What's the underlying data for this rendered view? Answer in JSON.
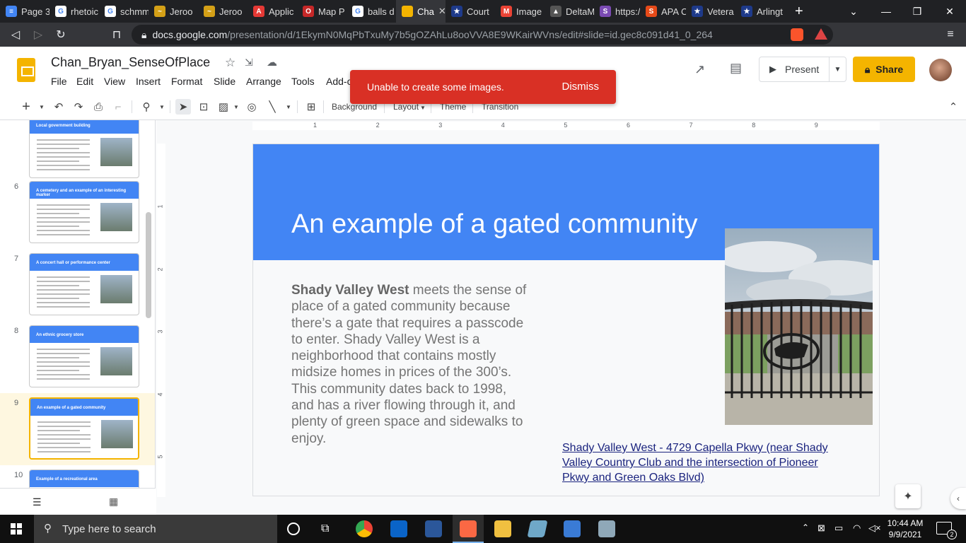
{
  "browser": {
    "tabs": [
      {
        "label": "Page 3",
        "color": "#4285f4",
        "glyph": "≡"
      },
      {
        "label": "rhetoic",
        "color": "#ffffff",
        "glyph": "G"
      },
      {
        "label": "schmm",
        "color": "#ffffff",
        "glyph": "G"
      },
      {
        "label": "Jeroo",
        "color": "#d4a017",
        "glyph": "~"
      },
      {
        "label": "Jeroo",
        "color": "#d4a017",
        "glyph": "~"
      },
      {
        "label": "Applic",
        "color": "#e53935",
        "glyph": "A"
      },
      {
        "label": "Map P",
        "color": "#c62828",
        "glyph": "O"
      },
      {
        "label": "balls d",
        "color": "#ffffff",
        "glyph": "G"
      },
      {
        "label": "Cha",
        "color": "#f4b400",
        "glyph": ""
      },
      {
        "label": "Court",
        "color": "#1e3a8a",
        "glyph": "★"
      },
      {
        "label": "Image",
        "color": "#ea4335",
        "glyph": "M"
      },
      {
        "label": "DeltaM",
        "color": "#555555",
        "glyph": "▲"
      },
      {
        "label": "https:/",
        "color": "#7b4bb3",
        "glyph": "S"
      },
      {
        "label": "APA Ci",
        "color": "#e64a19",
        "glyph": "S"
      },
      {
        "label": "Vetera",
        "color": "#1e3a8a",
        "glyph": "★"
      },
      {
        "label": "Arlingt",
        "color": "#1e3a8a",
        "glyph": "★"
      }
    ],
    "url_domain": "docs.google.com",
    "url_path": "/presentation/d/1EkymN0MqPbTxuMy7b5gOZAhLu8ooVVA8E9WKairWVns/edit#slide=id.gec8c091d41_0_264"
  },
  "docs": {
    "title": "Chan_Bryan_SenseOfPlace",
    "menu": [
      "File",
      "Edit",
      "View",
      "Insert",
      "Format",
      "Slide",
      "Arrange",
      "Tools",
      "Add-o"
    ],
    "present_label": "Present",
    "share_label": "Share"
  },
  "snackbar": {
    "message": "Unable to create some images.",
    "action": "Dismiss"
  },
  "toolbar": {
    "background": "Background",
    "layout": "Layout",
    "theme": "Theme",
    "transition": "Transition"
  },
  "filmstrip": {
    "slides": [
      {
        "num": "",
        "title": "Local government building",
        "selected": false
      },
      {
        "num": "6",
        "title": "A cemetery and an example of an interesting marker",
        "selected": false
      },
      {
        "num": "7",
        "title": "A concert hall or performance center",
        "selected": false
      },
      {
        "num": "8",
        "title": "An ethnic grocery store",
        "selected": false
      },
      {
        "num": "9",
        "title": "An example of a gated community",
        "selected": true
      },
      {
        "num": "10",
        "title": "Example of a recreational area",
        "selected": false
      }
    ]
  },
  "ruler": {
    "h": [
      "1",
      "2",
      "3",
      "4",
      "5",
      "6",
      "7",
      "8",
      "9"
    ],
    "v": [
      "1",
      "2",
      "3",
      "4",
      "5"
    ]
  },
  "slide": {
    "title": "An example of a gated community",
    "body_bold": "Shady Valley West",
    "body_rest": " meets the sense of place of a gated community because there’s a gate that requires a passcode to enter. Shady Valley West is a neighborhood that contains mostly midsize homes in prices of the 300’s. This community dates back to 1998, and has a river flowing through it, and plenty of green space and sidewalks to enjoy.",
    "link": "Shady Valley West - 4729 Capella Pkwy (near Shady Valley Country Club and the intersection of Pioneer Pkwy and Green Oaks Blvd)"
  },
  "taskbar": {
    "search_placeholder": "Type here to search",
    "time": "10:44 AM",
    "date": "9/9/2021",
    "notification_count": "2"
  }
}
